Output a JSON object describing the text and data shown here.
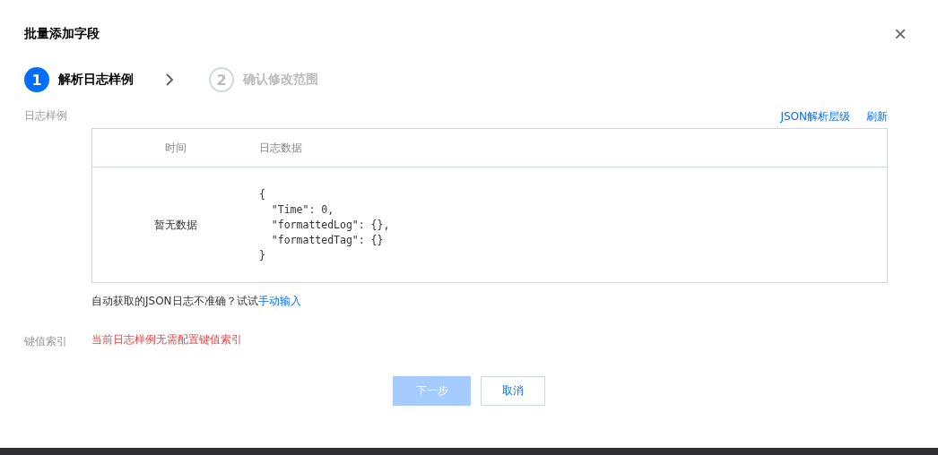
{
  "dialog": {
    "title": "批量添加字段",
    "close": "×"
  },
  "steps": [
    {
      "number": "1",
      "label": "解析日志样例",
      "selected": true
    },
    {
      "number": "2",
      "label": "确认修改范围",
      "selected": false
    }
  ],
  "sample": {
    "label": "日志样例",
    "links": [
      "JSON解析层级",
      "刷新"
    ],
    "table": {
      "columns": [
        "时间",
        "日志数据"
      ],
      "rows": [
        {
          "time": "暂无数据",
          "data": [
            "{",
            "  \"Time\": 0,",
            "  \"formattedLog\": {},",
            "  \"formattedTag\": {}",
            "}"
          ]
        }
      ]
    },
    "hint": "自动获取的JSON日志不准确？试试",
    "hint_link": "手动输入"
  },
  "index": {
    "label": "键值索引",
    "message": "当前日志样例无需配置键值索引"
  },
  "buttons": [
    {
      "label": "下一步",
      "kind": "primary",
      "disabled": true
    },
    {
      "label": "取消",
      "kind": "secondary",
      "disabled": false
    }
  ]
}
